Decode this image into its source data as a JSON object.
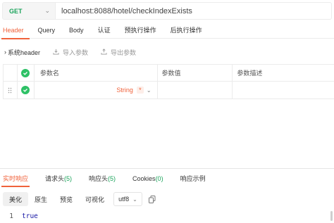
{
  "request": {
    "method": "GET",
    "url": "localhost:8088/hotel/checkIndexExists"
  },
  "request_tabs": [
    {
      "label": "Header",
      "active": true
    },
    {
      "label": "Query",
      "active": false
    },
    {
      "label": "Body",
      "active": false
    },
    {
      "label": "认证",
      "active": false
    },
    {
      "label": "预执行操作",
      "active": false
    },
    {
      "label": "后执行操作",
      "active": false
    }
  ],
  "toolbar": {
    "system_header": "系统header",
    "import_params": "导入参数",
    "export_params": "导出参数"
  },
  "params_table": {
    "headers": [
      "参数名",
      "参数值",
      "参数描述"
    ],
    "rows": [
      {
        "name": "",
        "type": "String",
        "required_mark": "*",
        "value": "",
        "description": "",
        "enabled": true
      }
    ]
  },
  "response_tabs": [
    {
      "label": "实时响应",
      "count": "",
      "active": true
    },
    {
      "label": "请求头",
      "count": "(5)",
      "active": false
    },
    {
      "label": "响应头",
      "count": "(5)",
      "active": false
    },
    {
      "label": "Cookies",
      "count": "(0)",
      "active": false
    },
    {
      "label": "响应示例",
      "count": "",
      "active": false
    }
  ],
  "response_toolbar": {
    "beautify": "美化",
    "raw": "原生",
    "preview": "预览",
    "visualize": "可视化",
    "encoding": "utf8"
  },
  "response_body": {
    "line_number": "1",
    "content": "true"
  },
  "colors": {
    "accent": "#f0623b",
    "method_get": "#1ba45b",
    "checkbox": "#2ec166"
  }
}
